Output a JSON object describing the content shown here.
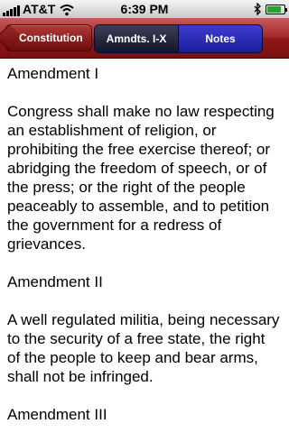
{
  "status_bar": {
    "carrier": "AT&T",
    "time": "6:39 PM",
    "icons": [
      "signal-icon",
      "wifi-icon",
      "bluetooth-icon",
      "battery-icon"
    ],
    "battery_level": 0.85
  },
  "nav_bar": {
    "back_label": "Constitution",
    "segments": [
      {
        "label": "Amndts. I-X",
        "selected": true
      },
      {
        "label": "Notes",
        "selected": false
      }
    ],
    "colors": {
      "bar": "#8e1717",
      "segment_selected": "#1c1c32",
      "segment": "#2a2ab8"
    }
  },
  "content": {
    "blocks": [
      "Amendment I",
      "Congress shall make no law respecting an establishment of religion, or prohibiting the free exercise thereof; or abridging the freedom of speech, or of the press; or the right of the people peaceably to assemble, and to petition the government for a redress of grievances.",
      "Amendment II",
      "A well regulated militia, being necessary to the security of a free state, the right of the people to keep and bear arms, shall not be infringed.",
      "Amendment III"
    ]
  }
}
